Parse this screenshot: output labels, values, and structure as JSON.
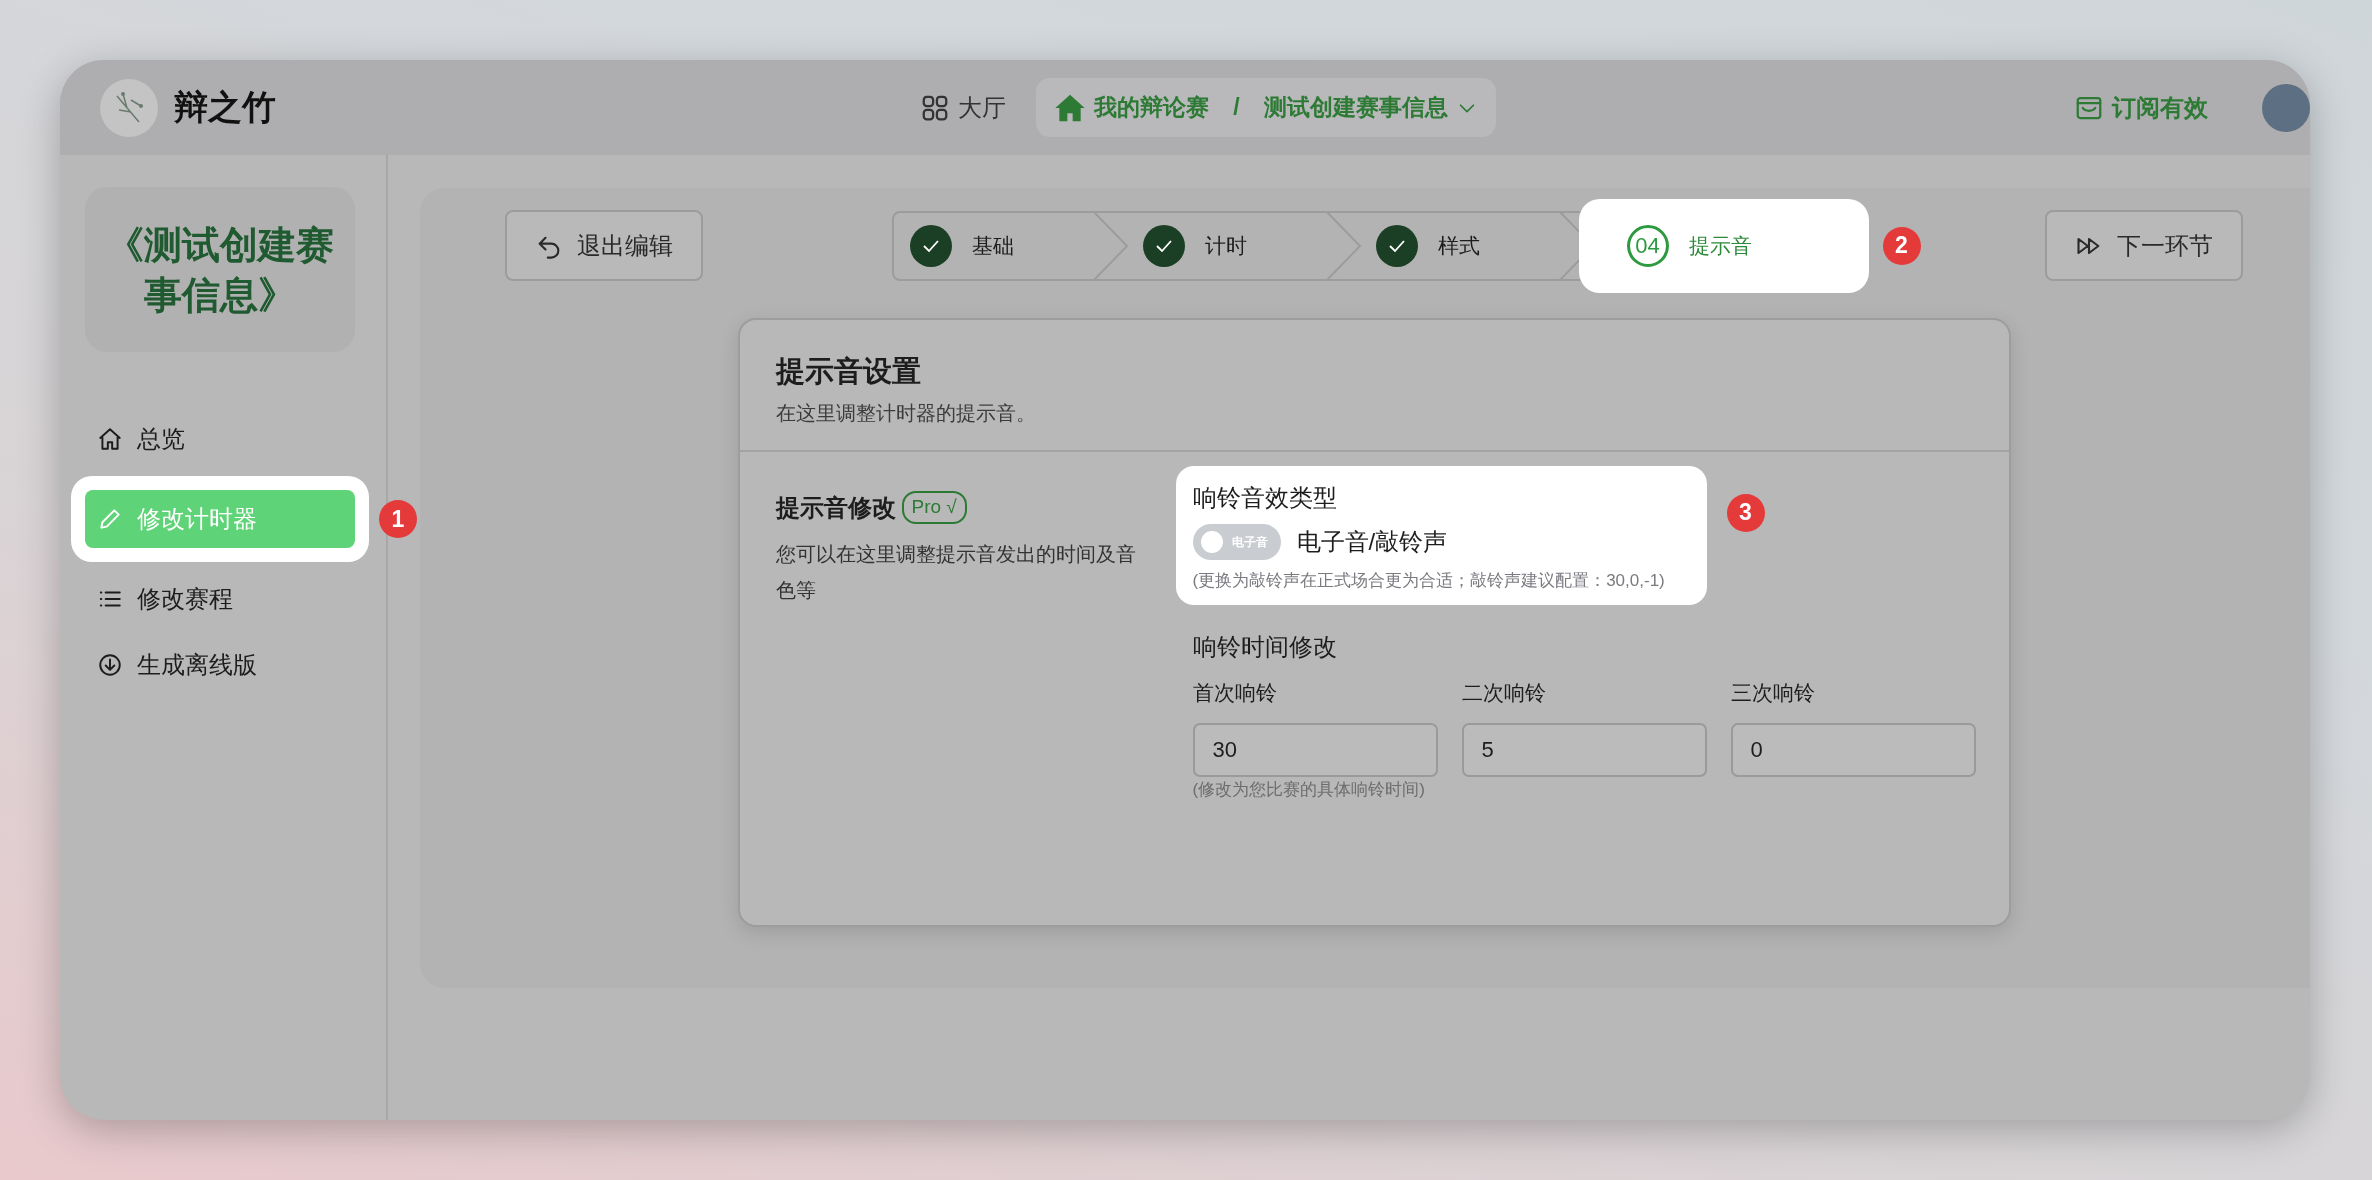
{
  "header": {
    "logo_text": "辩之竹",
    "hall": "大厅",
    "breadcrumb": [
      {
        "label": "我的辩论赛",
        "kind": "home"
      },
      {
        "label": "测试创建赛事信息",
        "kind": "dropdown"
      }
    ],
    "breadcrumb_separator": "/",
    "subscription": "订阅有效"
  },
  "sidebar": {
    "title": "《测试创建赛事信息》",
    "items": [
      {
        "label": "总览",
        "kind": "home",
        "selected": false
      },
      {
        "label": "修改计时器",
        "kind": "pencil",
        "selected": true,
        "callout": "1"
      },
      {
        "label": "修改赛程",
        "kind": "list",
        "selected": false
      },
      {
        "label": "生成离线版",
        "kind": "download",
        "selected": false
      }
    ]
  },
  "toolbar": {
    "exit_button": "退出编辑",
    "next_button": "下一环节"
  },
  "steps": [
    {
      "label": "基础",
      "done": true,
      "selected": false
    },
    {
      "label": "计时",
      "done": true,
      "selected": false
    },
    {
      "label": "样式",
      "done": true,
      "selected": false
    },
    {
      "label": "提示音",
      "done": false,
      "number": "04",
      "selected": true,
      "callout": "2"
    }
  ],
  "card": {
    "title": "提示音设置",
    "subtitle": "在这里调整计时器的提示音。",
    "section": {
      "title": "提示音修改",
      "badge": "Pro √",
      "description": "您可以在这里调整提示音发出的时间及音色等"
    },
    "sound_type": {
      "title": "响铃音效类型",
      "toggle_text": "电子音",
      "on": false,
      "label": "电子音/敲铃声",
      "hint": "(更换为敲铃声在正式场合更为合适；敲铃声建议配置：30,0,-1)",
      "highlighted": true,
      "callout": "3"
    },
    "timing": {
      "title": "响铃时间修改",
      "fields": [
        {
          "label": "首次响铃",
          "value": "30"
        },
        {
          "label": "二次响铃",
          "value": "5"
        },
        {
          "label": "三次响铃",
          "value": "0"
        }
      ],
      "hint": "(修改为您比赛的具体响铃时间)"
    }
  }
}
